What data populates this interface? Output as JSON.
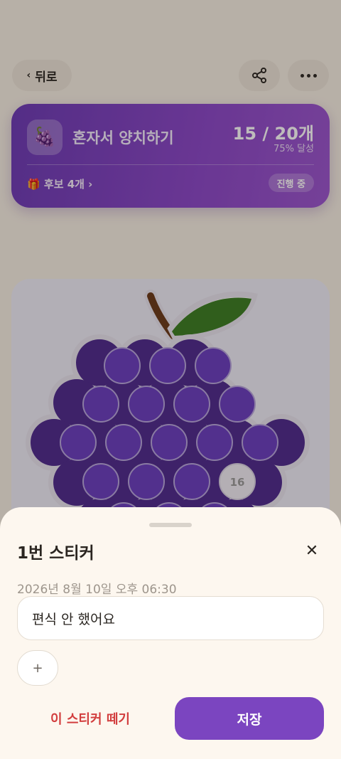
{
  "header": {
    "back_label": "뒤로",
    "back_icon": "chevron-left-icon",
    "share_icon": "share-icon",
    "more_icon": "more-horizontal-icon"
  },
  "goal": {
    "icon": "🍇",
    "title": "혼자서 양치하기",
    "count_text": "15 / 20개",
    "percent_text": "75% 달성",
    "reward_text": "🎁 후보 4개 ›",
    "status": "진행 중",
    "gradient_colors": [
      "#6c3ab6",
      "#9b55cf"
    ]
  },
  "board": {
    "shape": "grape",
    "stickers_total": 20,
    "stickers_filled": 15,
    "next_number_label": "16",
    "grape_color": "#4e2a8e",
    "berry_color": "#6a3dc0",
    "leaf_color": "#3b7d23",
    "stem_color": "#6a3a1a"
  },
  "sheet": {
    "title": "1번 스티커",
    "close_icon": "close-icon",
    "date": "2026년 8월 10일 오후 06:30",
    "memo_value": "편식 안 했어요",
    "add_label": "+",
    "remove_label": "이 스티커 떼기",
    "save_label": "저장",
    "accent_color": "#7b45c0",
    "danger_color": "#d23e3e"
  }
}
